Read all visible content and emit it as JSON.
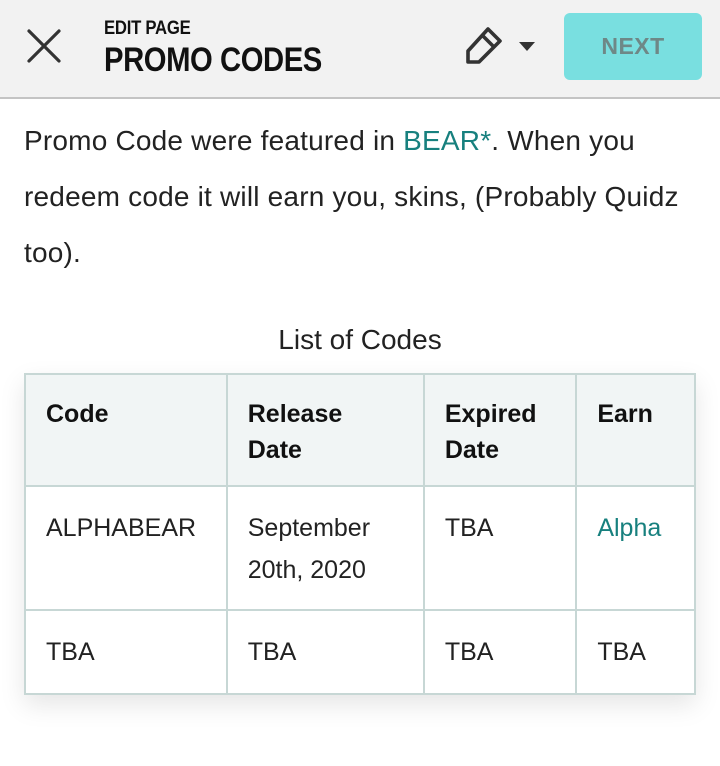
{
  "header": {
    "subtitle": "EDIT PAGE",
    "title": "PROMO CODES",
    "close_icon": "close-icon",
    "edit_icon": "pencil-icon",
    "dropdown_icon": "caret-down-icon",
    "next_label": "NEXT",
    "next_color": "#79dfe0"
  },
  "intro": {
    "text_before": "Promo Code were featured in ",
    "link_text": "BEAR*",
    "text_after": ". When you redeem code it will earn you, skins, (Probably Quidz too).",
    "link_color": "#17807e"
  },
  "table": {
    "caption": "List of Codes",
    "headers": [
      "Code",
      "Release Date",
      "Expired Date",
      "Earn"
    ],
    "rows": [
      [
        "ALPHABEAR",
        "September 20th, 2020",
        "TBA",
        "Alpha"
      ],
      [
        "TBA",
        "TBA",
        "TBA",
        "TBA"
      ]
    ]
  }
}
